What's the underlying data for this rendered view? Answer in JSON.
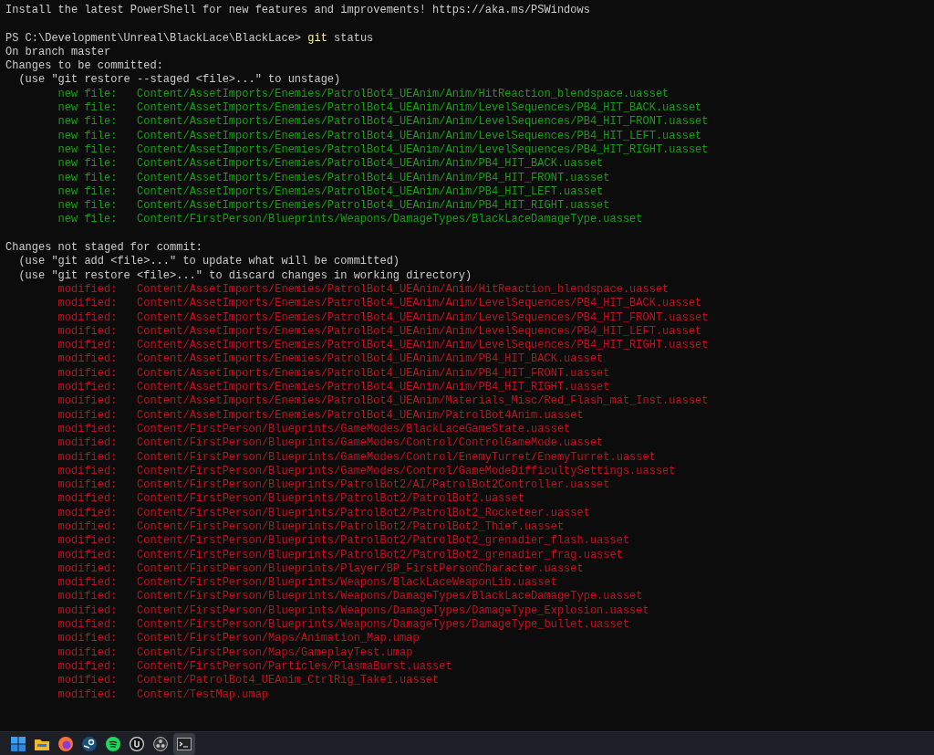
{
  "banner": "Install the latest PowerShell for new features and improvements! https://aka.ms/PSWindows",
  "prompt": {
    "text": "PS C:\\Development\\Unreal\\BlackLace\\BlackLace>",
    "command": "git",
    "args": "status"
  },
  "branch_line": "On branch master",
  "sections": [
    {
      "kind": "staged",
      "heading": "Changes to be committed:",
      "hints": [
        "(use \"git restore --staged <file>...\" to unstage)"
      ],
      "entries": [
        {
          "status": "new file:",
          "path": "Content/AssetImports/Enemies/PatrolBot4_UEAnim/Anim/HitReaction_blendspace.uasset"
        },
        {
          "status": "new file:",
          "path": "Content/AssetImports/Enemies/PatrolBot4_UEAnim/Anim/LevelSequences/PB4_HIT_BACK.uasset"
        },
        {
          "status": "new file:",
          "path": "Content/AssetImports/Enemies/PatrolBot4_UEAnim/Anim/LevelSequences/PB4_HIT_FRONT.uasset"
        },
        {
          "status": "new file:",
          "path": "Content/AssetImports/Enemies/PatrolBot4_UEAnim/Anim/LevelSequences/PB4_HIT_LEFT.uasset"
        },
        {
          "status": "new file:",
          "path": "Content/AssetImports/Enemies/PatrolBot4_UEAnim/Anim/LevelSequences/PB4_HIT_RIGHT.uasset"
        },
        {
          "status": "new file:",
          "path": "Content/AssetImports/Enemies/PatrolBot4_UEAnim/Anim/PB4_HIT_BACK.uasset"
        },
        {
          "status": "new file:",
          "path": "Content/AssetImports/Enemies/PatrolBot4_UEAnim/Anim/PB4_HIT_FRONT.uasset"
        },
        {
          "status": "new file:",
          "path": "Content/AssetImports/Enemies/PatrolBot4_UEAnim/Anim/PB4_HIT_LEFT.uasset"
        },
        {
          "status": "new file:",
          "path": "Content/AssetImports/Enemies/PatrolBot4_UEAnim/Anim/PB4_HIT_RIGHT.uasset"
        },
        {
          "status": "new file:",
          "path": "Content/FirstPerson/Blueprints/Weapons/DamageTypes/BlackLaceDamageType.uasset"
        }
      ]
    },
    {
      "kind": "unstaged",
      "heading": "Changes not staged for commit:",
      "hints": [
        "(use \"git add <file>...\" to update what will be committed)",
        "(use \"git restore <file>...\" to discard changes in working directory)"
      ],
      "entries": [
        {
          "status": "modified:",
          "path": "Content/AssetImports/Enemies/PatrolBot4_UEAnim/Anim/HitReaction_blendspace.uasset"
        },
        {
          "status": "modified:",
          "path": "Content/AssetImports/Enemies/PatrolBot4_UEAnim/Anim/LevelSequences/PB4_HIT_BACK.uasset"
        },
        {
          "status": "modified:",
          "path": "Content/AssetImports/Enemies/PatrolBot4_UEAnim/Anim/LevelSequences/PB4_HIT_FRONT.uasset"
        },
        {
          "status": "modified:",
          "path": "Content/AssetImports/Enemies/PatrolBot4_UEAnim/Anim/LevelSequences/PB4_HIT_LEFT.uasset"
        },
        {
          "status": "modified:",
          "path": "Content/AssetImports/Enemies/PatrolBot4_UEAnim/Anim/LevelSequences/PB4_HIT_RIGHT.uasset"
        },
        {
          "status": "modified:",
          "path": "Content/AssetImports/Enemies/PatrolBot4_UEAnim/Anim/PB4_HIT_BACK.uasset"
        },
        {
          "status": "modified:",
          "path": "Content/AssetImports/Enemies/PatrolBot4_UEAnim/Anim/PB4_HIT_FRONT.uasset"
        },
        {
          "status": "modified:",
          "path": "Content/AssetImports/Enemies/PatrolBot4_UEAnim/Anim/PB4_HIT_RIGHT.uasset"
        },
        {
          "status": "modified:",
          "path": "Content/AssetImports/Enemies/PatrolBot4_UEAnim/Materials_Misc/Red_Flash_mat_Inst.uasset"
        },
        {
          "status": "modified:",
          "path": "Content/AssetImports/Enemies/PatrolBot4_UEAnim/PatrolBot4Anim.uasset"
        },
        {
          "status": "modified:",
          "path": "Content/FirstPerson/Blueprints/GameModes/BlackLaceGameState.uasset"
        },
        {
          "status": "modified:",
          "path": "Content/FirstPerson/Blueprints/GameModes/Control/ControlGameMode.uasset"
        },
        {
          "status": "modified:",
          "path": "Content/FirstPerson/Blueprints/GameModes/Control/EnemyTurret/EnemyTurret.uasset"
        },
        {
          "status": "modified:",
          "path": "Content/FirstPerson/Blueprints/GameModes/Control/GameModeDifficultySettings.uasset"
        },
        {
          "status": "modified:",
          "path": "Content/FirstPerson/Blueprints/PatrolBot2/AI/PatrolBot2Controller.uasset"
        },
        {
          "status": "modified:",
          "path": "Content/FirstPerson/Blueprints/PatrolBot2/PatrolBot2.uasset"
        },
        {
          "status": "modified:",
          "path": "Content/FirstPerson/Blueprints/PatrolBot2/PatrolBot2_Rocketeer.uasset"
        },
        {
          "status": "modified:",
          "path": "Content/FirstPerson/Blueprints/PatrolBot2/PatrolBot2_Thief.uasset"
        },
        {
          "status": "modified:",
          "path": "Content/FirstPerson/Blueprints/PatrolBot2/PatrolBot2_grenadier_flash.uasset"
        },
        {
          "status": "modified:",
          "path": "Content/FirstPerson/Blueprints/PatrolBot2/PatrolBot2_grenadier_frag.uasset"
        },
        {
          "status": "modified:",
          "path": "Content/FirstPerson/Blueprints/Player/BP_FirstPersonCharacter.uasset"
        },
        {
          "status": "modified:",
          "path": "Content/FirstPerson/Blueprints/Weapons/BlackLaceWeaponLib.uasset"
        },
        {
          "status": "modified:",
          "path": "Content/FirstPerson/Blueprints/Weapons/DamageTypes/BlackLaceDamageType.uasset"
        },
        {
          "status": "modified:",
          "path": "Content/FirstPerson/Blueprints/Weapons/DamageTypes/DamageType_Explosion.uasset"
        },
        {
          "status": "modified:",
          "path": "Content/FirstPerson/Blueprints/Weapons/DamageTypes/DamageType_bullet.uasset"
        },
        {
          "status": "modified:",
          "path": "Content/FirstPerson/Maps/Animation_Map.umap"
        },
        {
          "status": "modified:",
          "path": "Content/FirstPerson/Maps/GameplayTest.umap"
        },
        {
          "status": "modified:",
          "path": "Content/FirstPerson/Particles/PlasmaBurst.uasset"
        },
        {
          "status": "modified:",
          "path": "Content/PatrolBot4_UEAnim_CtrlRig_Take1.uasset"
        },
        {
          "status": "modified:",
          "path": "Content/TestMap.umap"
        }
      ]
    }
  ],
  "taskbar": {
    "apps": [
      {
        "kind": "start",
        "selected": false
      },
      {
        "kind": "folder",
        "selected": false
      },
      {
        "kind": "browser",
        "selected": false
      },
      {
        "kind": "steam",
        "selected": false
      },
      {
        "kind": "music",
        "selected": false
      },
      {
        "kind": "engine",
        "selected": false
      },
      {
        "kind": "recorder",
        "selected": false
      },
      {
        "kind": "terminal",
        "selected": true
      }
    ]
  }
}
